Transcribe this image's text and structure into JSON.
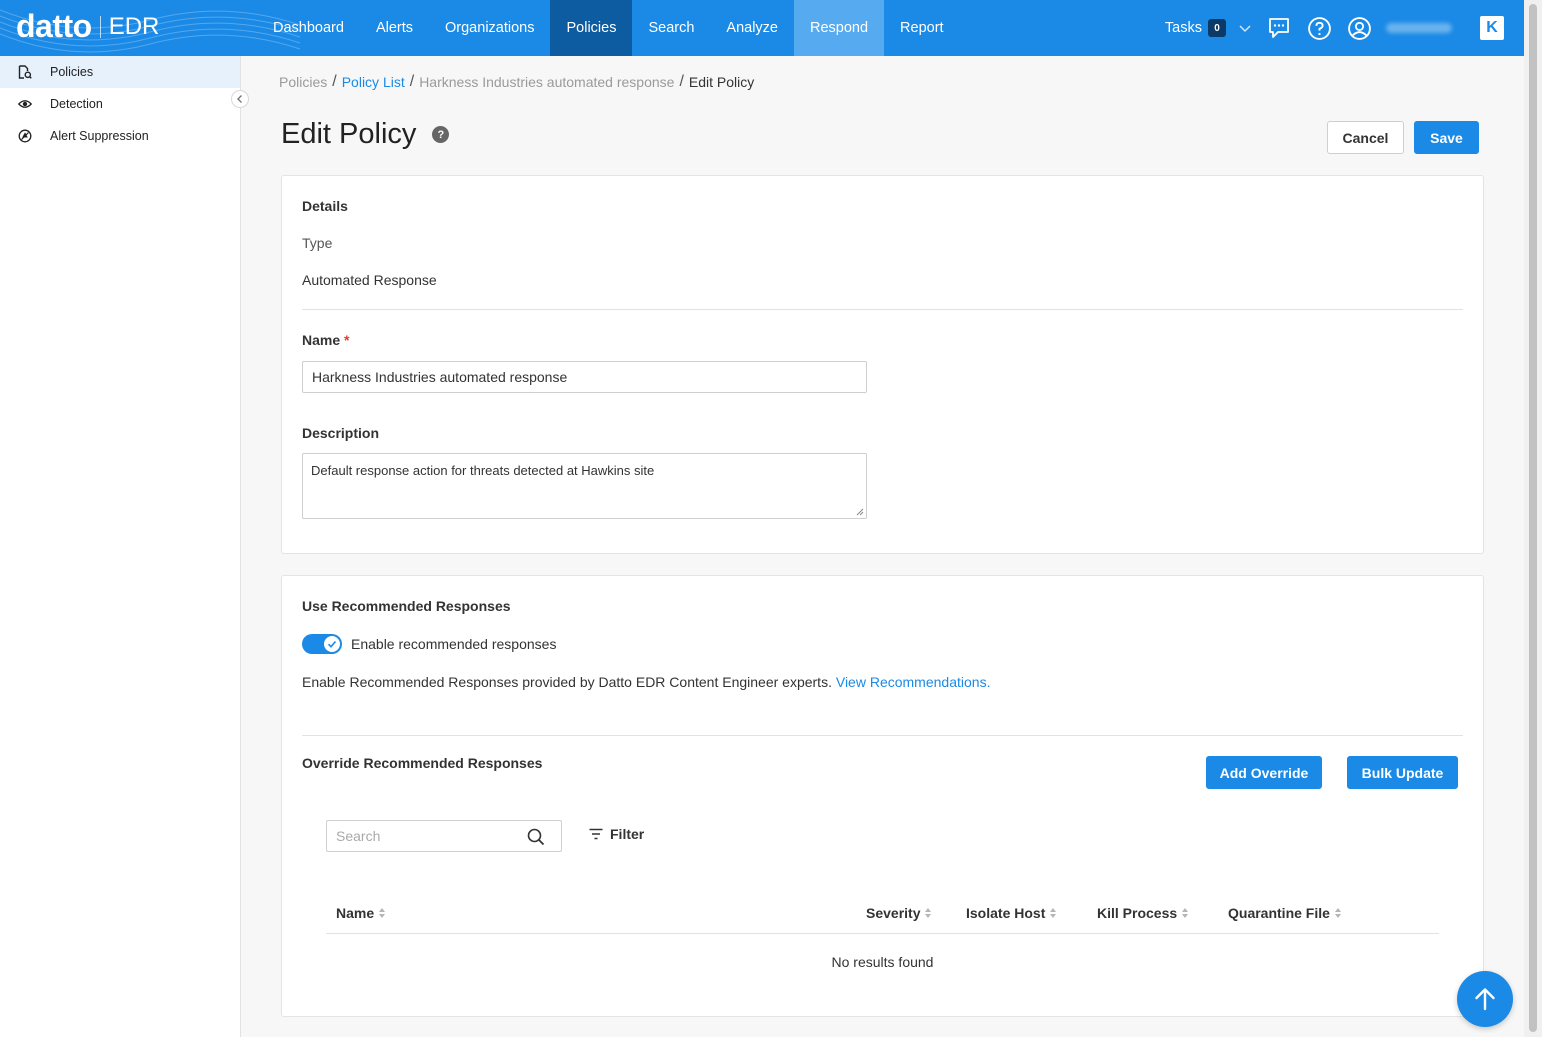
{
  "app": {
    "brand": "datto",
    "product": "EDR"
  },
  "nav": {
    "items": [
      "Dashboard",
      "Alerts",
      "Organizations",
      "Policies",
      "Search",
      "Analyze",
      "Respond",
      "Report"
    ],
    "active": "Policies",
    "hover": "Respond"
  },
  "topbar": {
    "tasks_label": "Tasks",
    "tasks_count": "0",
    "k_label": "K"
  },
  "sidebar": {
    "items": [
      {
        "label": "Policies",
        "icon": "policy-doc-icon",
        "active": true
      },
      {
        "label": "Detection",
        "icon": "eye-icon",
        "active": false
      },
      {
        "label": "Alert Suppression",
        "icon": "suppression-icon",
        "active": false
      }
    ]
  },
  "breadcrumb": {
    "items": [
      "Policies",
      "Policy List",
      "Harkness Industries automated response",
      "Edit Policy"
    ]
  },
  "page": {
    "title": "Edit Policy",
    "help": "?",
    "cancel_label": "Cancel",
    "save_label": "Save"
  },
  "details": {
    "heading": "Details",
    "type_label": "Type",
    "type_value": "Automated Response",
    "name_label": "Name",
    "required_mark": "*",
    "name_value": "Harkness Industries automated response",
    "description_label": "Description",
    "description_value": "Default response action for threats detected at Hawkins site"
  },
  "recommended": {
    "heading": "Use Recommended Responses",
    "toggle_label": "Enable recommended responses",
    "toggle_on": true,
    "info_text": "Enable Recommended Responses provided by Datto EDR Content Engineer experts.",
    "info_link": "View Recommendations."
  },
  "overrides": {
    "heading": "Override Recommended Responses",
    "add_label": "Add Override",
    "bulk_label": "Bulk Update",
    "search_placeholder": "Search",
    "filter_label": "Filter",
    "columns": [
      "Name",
      "Severity",
      "Isolate Host",
      "Kill Process",
      "Quarantine File"
    ],
    "empty_text": "No results found"
  },
  "colors": {
    "primary": "#1a8ae6",
    "nav_active": "#0d5ba0",
    "nav_hover": "#56aaf0"
  }
}
